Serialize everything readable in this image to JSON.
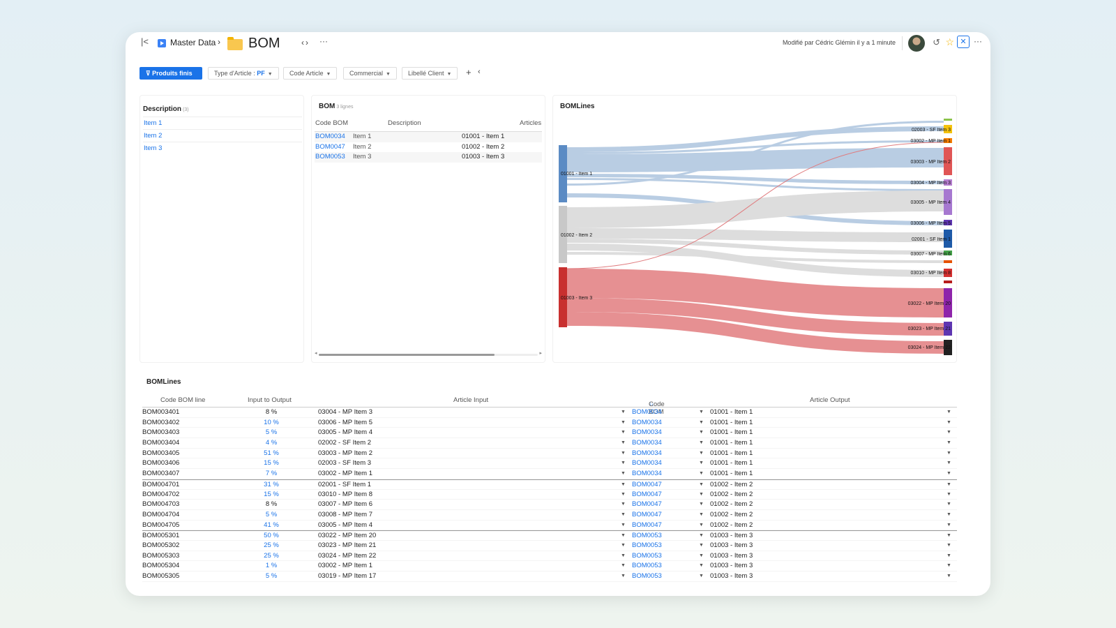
{
  "breadcrumb": {
    "parent": "Master Data",
    "title": "BOM"
  },
  "header": {
    "modified": "Modifié par Cédric Glémin il y a 1 minute"
  },
  "filters": {
    "active": "Produits finis",
    "type_label": "Type d'Article : ",
    "type_value": "PF",
    "code_article": "Code Article",
    "commercial": "Commercial",
    "libelle_client": "Libellé Client"
  },
  "description_card": {
    "title": "Description",
    "count": "(3)",
    "items": [
      "Item 1",
      "Item 2",
      "Item 3"
    ]
  },
  "bom_card": {
    "title": "BOM",
    "subtitle": "3 lignes",
    "columns": [
      "Code BOM",
      "Description",
      "Articles"
    ],
    "rows": [
      {
        "code": "BOM0034",
        "description": "Item 1",
        "article": "01001 - Item 1"
      },
      {
        "code": "BOM0047",
        "description": "Item 2",
        "article": "01002 - Item 2"
      },
      {
        "code": "BOM0053",
        "description": "Item 3",
        "article": "01003 - Item 3"
      }
    ]
  },
  "sankey": {
    "title": "BOMLines",
    "sources": [
      "01001 - Item 1",
      "01002 - Item 2",
      "01003 - Item 3"
    ],
    "targets": [
      "02003 - SF Item 3",
      "03002 - MP Item 1",
      "03003 - MP Item 2",
      "03004 - MP Item 3",
      "03005 - MP Item 4",
      "03006 - MP Item 5",
      "02001 - SF Item 1",
      "03007 - MP Item 6",
      "03010 - MP Item 8",
      "03022 - MP Item 20",
      "03023 - MP Item 21",
      "03024 - MP Item 22"
    ]
  },
  "lines_card": {
    "title": "BOMLines",
    "columns": {
      "code_bom_line": "Code BOM line",
      "input_to_output": "Input to Output",
      "article_input": "Article Input",
      "code_bom": "Code BOM",
      "article_output": "Article Output"
    },
    "rows": [
      {
        "code": "BOM003401",
        "pct": "8 %",
        "pct_link": false,
        "input": "03004 - MP Item 3",
        "bom": "BOM0034",
        "output": "01001 - Item 1"
      },
      {
        "code": "BOM003402",
        "pct": "10 %",
        "pct_link": true,
        "input": "03006 - MP Item 5",
        "bom": "BOM0034",
        "output": "01001 - Item 1"
      },
      {
        "code": "BOM003403",
        "pct": "5 %",
        "pct_link": true,
        "input": "03005 - MP Item 4",
        "bom": "BOM0034",
        "output": "01001 - Item 1"
      },
      {
        "code": "BOM003404",
        "pct": "4 %",
        "pct_link": true,
        "input": "02002 - SF Item 2",
        "bom": "BOM0034",
        "output": "01001 - Item 1"
      },
      {
        "code": "BOM003405",
        "pct": "51 %",
        "pct_link": true,
        "input": "03003 - MP Item 2",
        "bom": "BOM0034",
        "output": "01001 - Item 1"
      },
      {
        "code": "BOM003406",
        "pct": "15 %",
        "pct_link": true,
        "input": "02003 - SF Item 3",
        "bom": "BOM0034",
        "output": "01001 - Item 1"
      },
      {
        "code": "BOM003407",
        "pct": "7 %",
        "pct_link": true,
        "input": "03002 - MP Item 1",
        "bom": "BOM0034",
        "output": "01001 - Item 1"
      },
      {
        "code": "BOM004701",
        "pct": "31 %",
        "pct_link": true,
        "input": "02001 - SF Item 1",
        "bom": "BOM0047",
        "output": "01002 - Item 2"
      },
      {
        "code": "BOM004702",
        "pct": "15 %",
        "pct_link": true,
        "input": "03010 - MP Item 8",
        "bom": "BOM0047",
        "output": "01002 - Item 2"
      },
      {
        "code": "BOM004703",
        "pct": "8 %",
        "pct_link": false,
        "input": "03007 - MP Item 6",
        "bom": "BOM0047",
        "output": "01002 - Item 2"
      },
      {
        "code": "BOM004704",
        "pct": "5 %",
        "pct_link": true,
        "input": "03008 - MP Item 7",
        "bom": "BOM0047",
        "output": "01002 - Item 2"
      },
      {
        "code": "BOM004705",
        "pct": "41 %",
        "pct_link": true,
        "input": "03005 - MP Item 4",
        "bom": "BOM0047",
        "output": "01002 - Item 2"
      },
      {
        "code": "BOM005301",
        "pct": "50 %",
        "pct_link": true,
        "input": "03022 - MP Item 20",
        "bom": "BOM0053",
        "output": "01003 - Item 3"
      },
      {
        "code": "BOM005302",
        "pct": "25 %",
        "pct_link": true,
        "input": "03023 - MP Item 21",
        "bom": "BOM0053",
        "output": "01003 - Item 3"
      },
      {
        "code": "BOM005303",
        "pct": "25 %",
        "pct_link": true,
        "input": "03024 - MP Item 22",
        "bom": "BOM0053",
        "output": "01003 - Item 3"
      },
      {
        "code": "BOM005304",
        "pct": "1 %",
        "pct_link": true,
        "input": "03002 - MP Item 1",
        "bom": "BOM0053",
        "output": "01003 - Item 3"
      },
      {
        "code": "BOM005305",
        "pct": "5 %",
        "pct_link": true,
        "input": "03019 - MP Item 17",
        "bom": "BOM0053",
        "output": "01003 - Item 3"
      }
    ]
  },
  "colors": {
    "accent": "#1a73e8",
    "item1": "#5b8bc4",
    "item2": "#c8c8c8",
    "item3": "#c8302f"
  }
}
